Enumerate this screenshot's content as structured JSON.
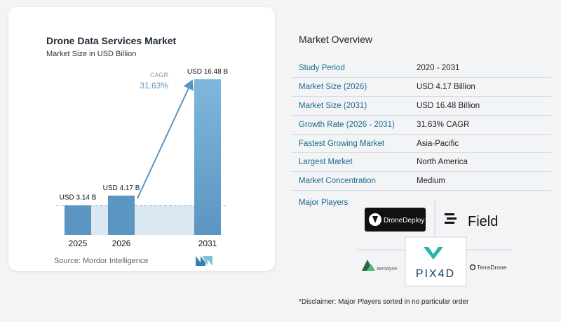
{
  "chart_data": {
    "type": "bar",
    "title": "Drone Data Services Market",
    "subtitle": "Market Size in USD Billion",
    "categories": [
      "2025",
      "2026",
      "2031"
    ],
    "values": [
      3.14,
      4.17,
      16.48
    ],
    "data_labels": [
      "USD 3.14 B",
      "USD 4.17 B",
      "USD 16.48 B"
    ],
    "cagr_label": "CAGR",
    "cagr_value": "31.63%",
    "colors": {
      "bar": "#5b95c1",
      "bar_top": "#7fb7dc",
      "band": "#dbe7f1",
      "arrow": "#5b95c1",
      "cagr": "#5b95c1"
    }
  },
  "source_label": "Source: Mordor Intelligence",
  "overview": {
    "title": "Market Overview",
    "rows": [
      {
        "key": "Study Period",
        "value": "2020 - 2031"
      },
      {
        "key": "Market Size (2026)",
        "value": "USD 4.17 Billion"
      },
      {
        "key": "Market Size (2031)",
        "value": "USD 16.48 Billion"
      },
      {
        "key": "Growth Rate (2026 - 2031)",
        "value": "31.63% CAGR"
      },
      {
        "key": "Fastest Growing Market",
        "value": "Asia-Pacific"
      },
      {
        "key": "Largest Market",
        "value": "North America"
      },
      {
        "key": "Market Concentration",
        "value": "Medium"
      }
    ]
  },
  "players": {
    "title": "Major Players",
    "logos": {
      "dronedeploy": "DroneDeploy",
      "field": "Field",
      "aerodyne": "aerodyne",
      "pix4d": "PIX4D",
      "terradrone": "TerraDrone"
    }
  },
  "disclaimer": "*Disclaimer: Major Players sorted in no particular order"
}
